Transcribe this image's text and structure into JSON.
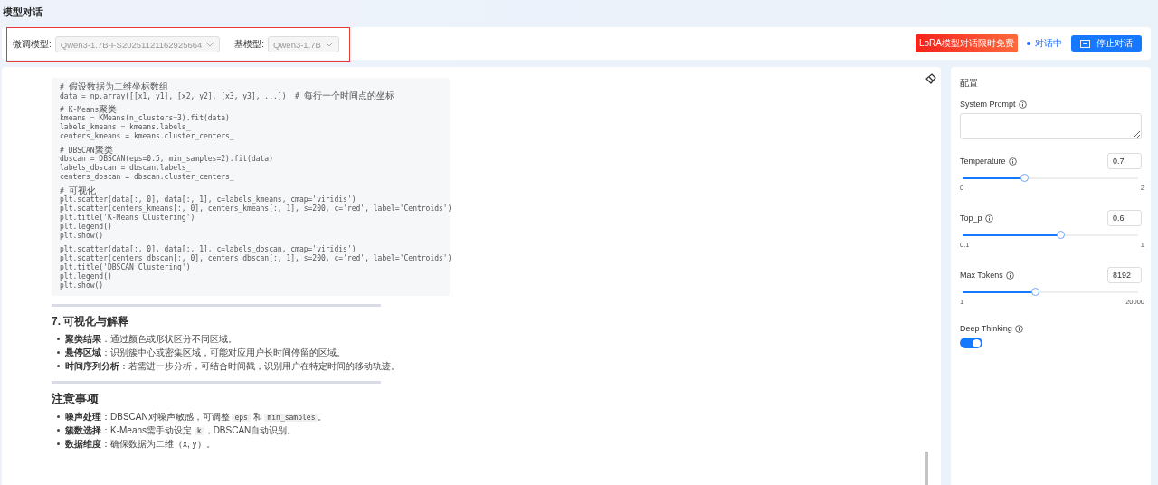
{
  "page_title": "模型对话",
  "model_bar": {
    "fields": [
      {
        "label": "微调模型:",
        "value": "Qwen3-1.7B-FS20251121162925664",
        "disabled": true
      },
      {
        "label": "基模型:",
        "value": "Qwen3-1.7B",
        "disabled": true
      }
    ],
    "badge": "LoRA模型对话限时免费",
    "status": "对话中",
    "stop_button": "停止对话"
  },
  "chat": {
    "code_blocks": [
      [
        "# 假设数据为二维坐标数组",
        "data = np.array([[x1, y1], [x2, y2], [x3, y3], ...])  # 每行一个时间点的坐标"
      ],
      [
        "# K-Means聚类",
        "kmeans = KMeans(n_clusters=3).fit(data)",
        "labels_kmeans = kmeans.labels_",
        "centers_kmeans = kmeans.cluster_centers_"
      ],
      [
        "# DBSCAN聚类",
        "dbscan = DBSCAN(eps=0.5, min_samples=2).fit(data)",
        "labels_dbscan = dbscan.labels_",
        "centers_dbscan = dbscan.cluster_centers_"
      ],
      [
        "# 可视化",
        "plt.scatter(data[:, 0], data[:, 1], c=labels_kmeans, cmap='viridis')",
        "plt.scatter(centers_kmeans[:, 0], centers_kmeans[:, 1], s=200, c='red', label='Centroids')",
        "plt.title('K-Means Clustering')",
        "plt.legend()",
        "plt.show()"
      ],
      [
        "plt.scatter(data[:, 0], data[:, 1], c=labels_dbscan, cmap='viridis')",
        "plt.scatter(centers_dbscan[:, 0], centers_dbscan[:, 1], s=200, c='red', label='Centroids')",
        "plt.title('DBSCAN Clustering')",
        "plt.legend()",
        "plt.show()"
      ]
    ],
    "sections": [
      {
        "heading": "7. 可视化与解释",
        "kind": "h3",
        "items": [
          {
            "term": "聚类结果",
            "segments": [
              {
                "kind": "text",
                "text": "：通过颜色或形状区分不同区域。"
              }
            ]
          },
          {
            "term": "悬停区域",
            "segments": [
              {
                "kind": "text",
                "text": "：识别簇中心或密集区域，可能对应用户长时间停留的区域。"
              }
            ]
          },
          {
            "term": "时间序列分析",
            "segments": [
              {
                "kind": "text",
                "text": "：若需进一步分析，可结合时间戳，识别用户在特定时间的移动轨迹。"
              }
            ]
          }
        ]
      },
      {
        "heading": "注意事项",
        "kind": "h2",
        "items": [
          {
            "term": "噪声处理",
            "segments": [
              {
                "kind": "text",
                "text": "：DBSCAN对噪声敏感，可调整 "
              },
              {
                "kind": "code",
                "text": "eps"
              },
              {
                "kind": "text",
                "text": " 和 "
              },
              {
                "kind": "code",
                "text": "min_samples"
              },
              {
                "kind": "text",
                "text": "。"
              }
            ]
          },
          {
            "term": "簇数选择",
            "segments": [
              {
                "kind": "text",
                "text": "：K-Means需手动设定 "
              },
              {
                "kind": "code",
                "text": "k"
              },
              {
                "kind": "text",
                "text": "，DBSCAN自动识别。"
              }
            ]
          },
          {
            "term": "数据维度",
            "segments": [
              {
                "kind": "text",
                "text": "：确保数据为二维（x, y）。"
              }
            ]
          }
        ]
      }
    ]
  },
  "config": {
    "title": "配置",
    "system_prompt": {
      "label": "System Prompt"
    },
    "sliders": [
      {
        "label": "Temperature",
        "value": "0.7",
        "level": 0.35,
        "min": "0",
        "max": "2"
      },
      {
        "label": "Top_p",
        "value": "0.6",
        "level": 0.556,
        "min": "0.1",
        "max": "1"
      },
      {
        "label": "Max Tokens",
        "value": "8192",
        "level": 0.41,
        "min": "1",
        "max": "20000"
      }
    ],
    "deep_thinking": {
      "label": "Deep Thinking",
      "on": true
    }
  }
}
